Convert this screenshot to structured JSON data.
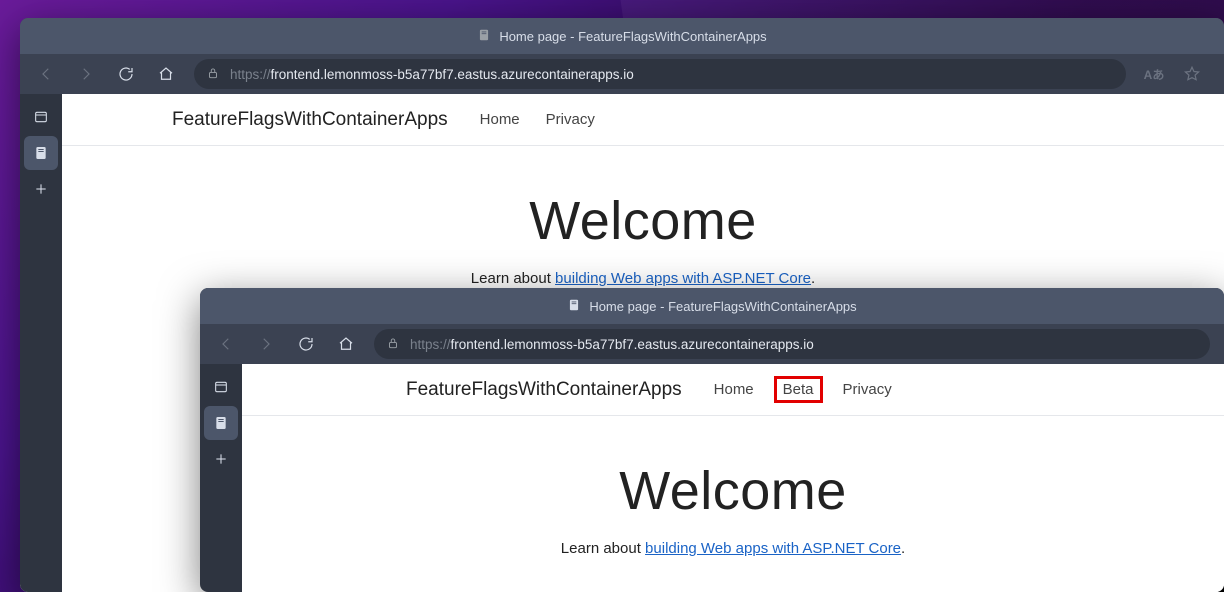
{
  "window1": {
    "tab_title": "Home page - FeatureFlagsWithContainerApps",
    "url": {
      "protocol": "https://",
      "host": "frontend.lemonmoss-b5a77bf7.eastus.azurecontainerapps.io",
      "path": ""
    },
    "site": {
      "brand": "FeatureFlagsWithContainerApps",
      "nav": [
        "Home",
        "Privacy"
      ]
    },
    "hero": {
      "title": "Welcome",
      "subtitle_prefix": "Learn about ",
      "subtitle_link": "building Web apps with ASP.NET Core",
      "subtitle_suffix": "."
    }
  },
  "window2": {
    "tab_title": "Home page - FeatureFlagsWithContainerApps",
    "url": {
      "protocol": "https://",
      "host": "frontend.lemonmoss-b5a77bf7.eastus.azurecontainerapps.io",
      "path": ""
    },
    "site": {
      "brand": "FeatureFlagsWithContainerApps",
      "nav": [
        "Home",
        "Beta",
        "Privacy"
      ],
      "highlight_index": 1
    },
    "hero": {
      "title": "Welcome",
      "subtitle_prefix": "Learn about ",
      "subtitle_link": "building Web apps with ASP.NET Core",
      "subtitle_suffix": "."
    }
  },
  "icons": {
    "reader_badge": "Aあ"
  }
}
